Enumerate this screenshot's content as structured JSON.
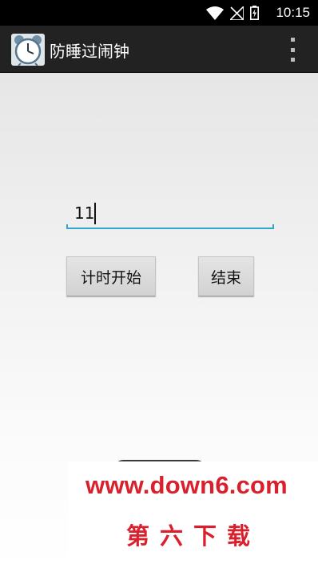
{
  "status_bar": {
    "time": "10:15",
    "icons": [
      "wifi-icon",
      "no-signal-icon",
      "battery-charging-icon"
    ]
  },
  "action_bar": {
    "title": "防睡过闹钟",
    "app_icon": "alarm-clock-icon",
    "menu_icon": "overflow-menu-icon"
  },
  "main": {
    "input_value": "11",
    "start_button": "计时开始",
    "end_button": "结束"
  },
  "watermark": {
    "url": "www.down6.com",
    "name": "第六下载"
  },
  "colors": {
    "accent": "#33a5c9",
    "action_bar": "#222222",
    "watermark": "#d9212e"
  }
}
